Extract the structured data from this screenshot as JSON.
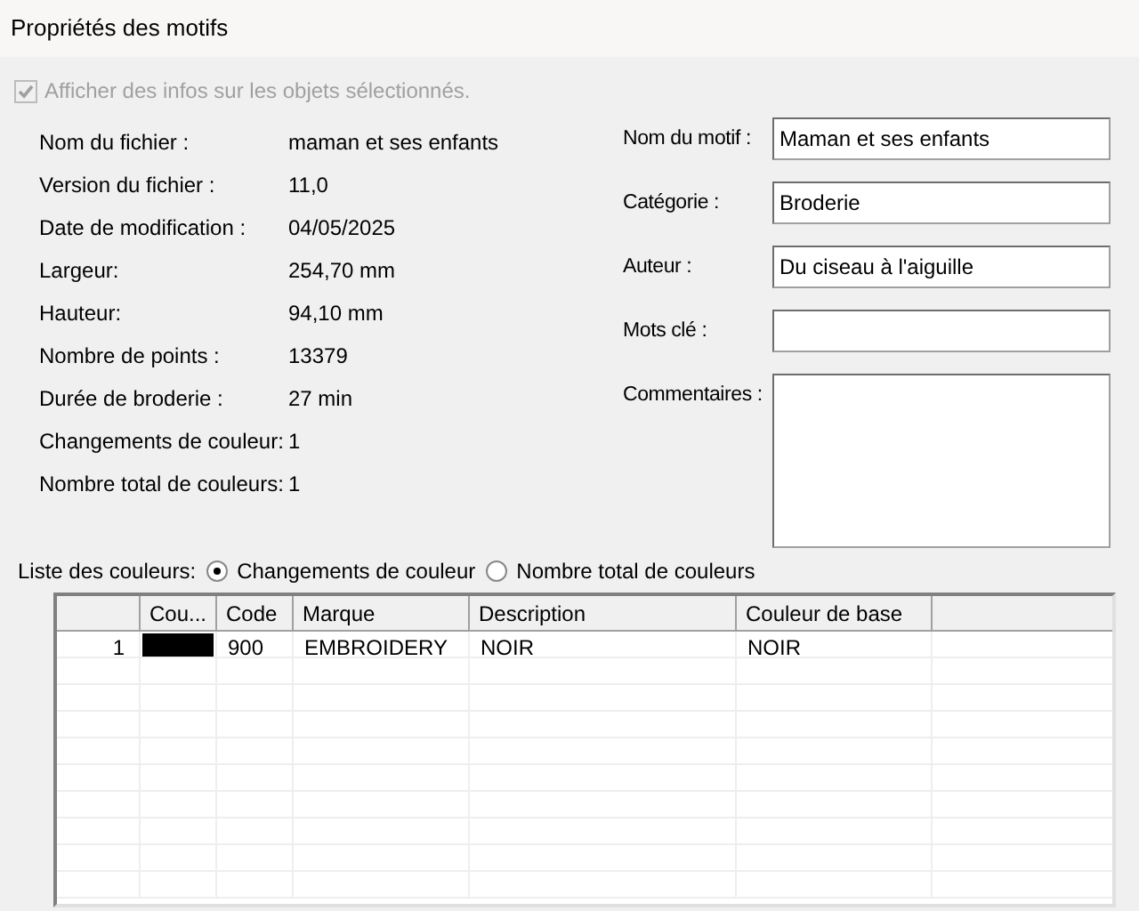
{
  "window": {
    "title": "Propriétés des motifs"
  },
  "show_info_checkbox": {
    "label": "Afficher des infos sur les objets sélectionnés.",
    "checked": true,
    "disabled": true
  },
  "file_info": [
    {
      "label": "Nom du fichier :",
      "value": "maman et ses enfants"
    },
    {
      "label": "Version du fichier :",
      "value": "11,0"
    },
    {
      "label": "Date de modification :",
      "value": "04/05/2025"
    },
    {
      "label": "Largeur:",
      "value": "254,70 mm"
    },
    {
      "label": "Hauteur:",
      "value": "94,10 mm"
    },
    {
      "label": "Nombre de points :",
      "value": "13379"
    },
    {
      "label": "Durée de broderie :",
      "value": "27 min"
    },
    {
      "label": "Changements de couleur:",
      "value": "1"
    },
    {
      "label": "Nombre total de couleurs:",
      "value": "1"
    }
  ],
  "fields": [
    {
      "label": "Nom du motif :",
      "value": "Maman et ses enfants",
      "kind": "line"
    },
    {
      "label": "Catégorie :",
      "value": "Broderie",
      "kind": "line"
    },
    {
      "label": "Auteur :",
      "value": "Du ciseau à l'aiguille",
      "kind": "line"
    },
    {
      "label": "Mots clé :",
      "kind": "line"
    },
    {
      "label": "Commentaires :",
      "kind": "multiline"
    }
  ],
  "color_list": {
    "label": "Liste des couleurs:",
    "options": [
      {
        "label": "Changements de couleur",
        "selected": true
      },
      {
        "label": "Nombre total de couleurs",
        "selected": false
      }
    ]
  },
  "table": {
    "columns": [
      "Cou...",
      "Code",
      "Marque",
      "Description",
      "Couleur de base"
    ],
    "rows": [
      {
        "index": "1",
        "color": "#000000",
        "code": "900",
        "brand": "EMBROIDERY",
        "description": "NOIR",
        "base_color": "NOIR"
      }
    ]
  }
}
